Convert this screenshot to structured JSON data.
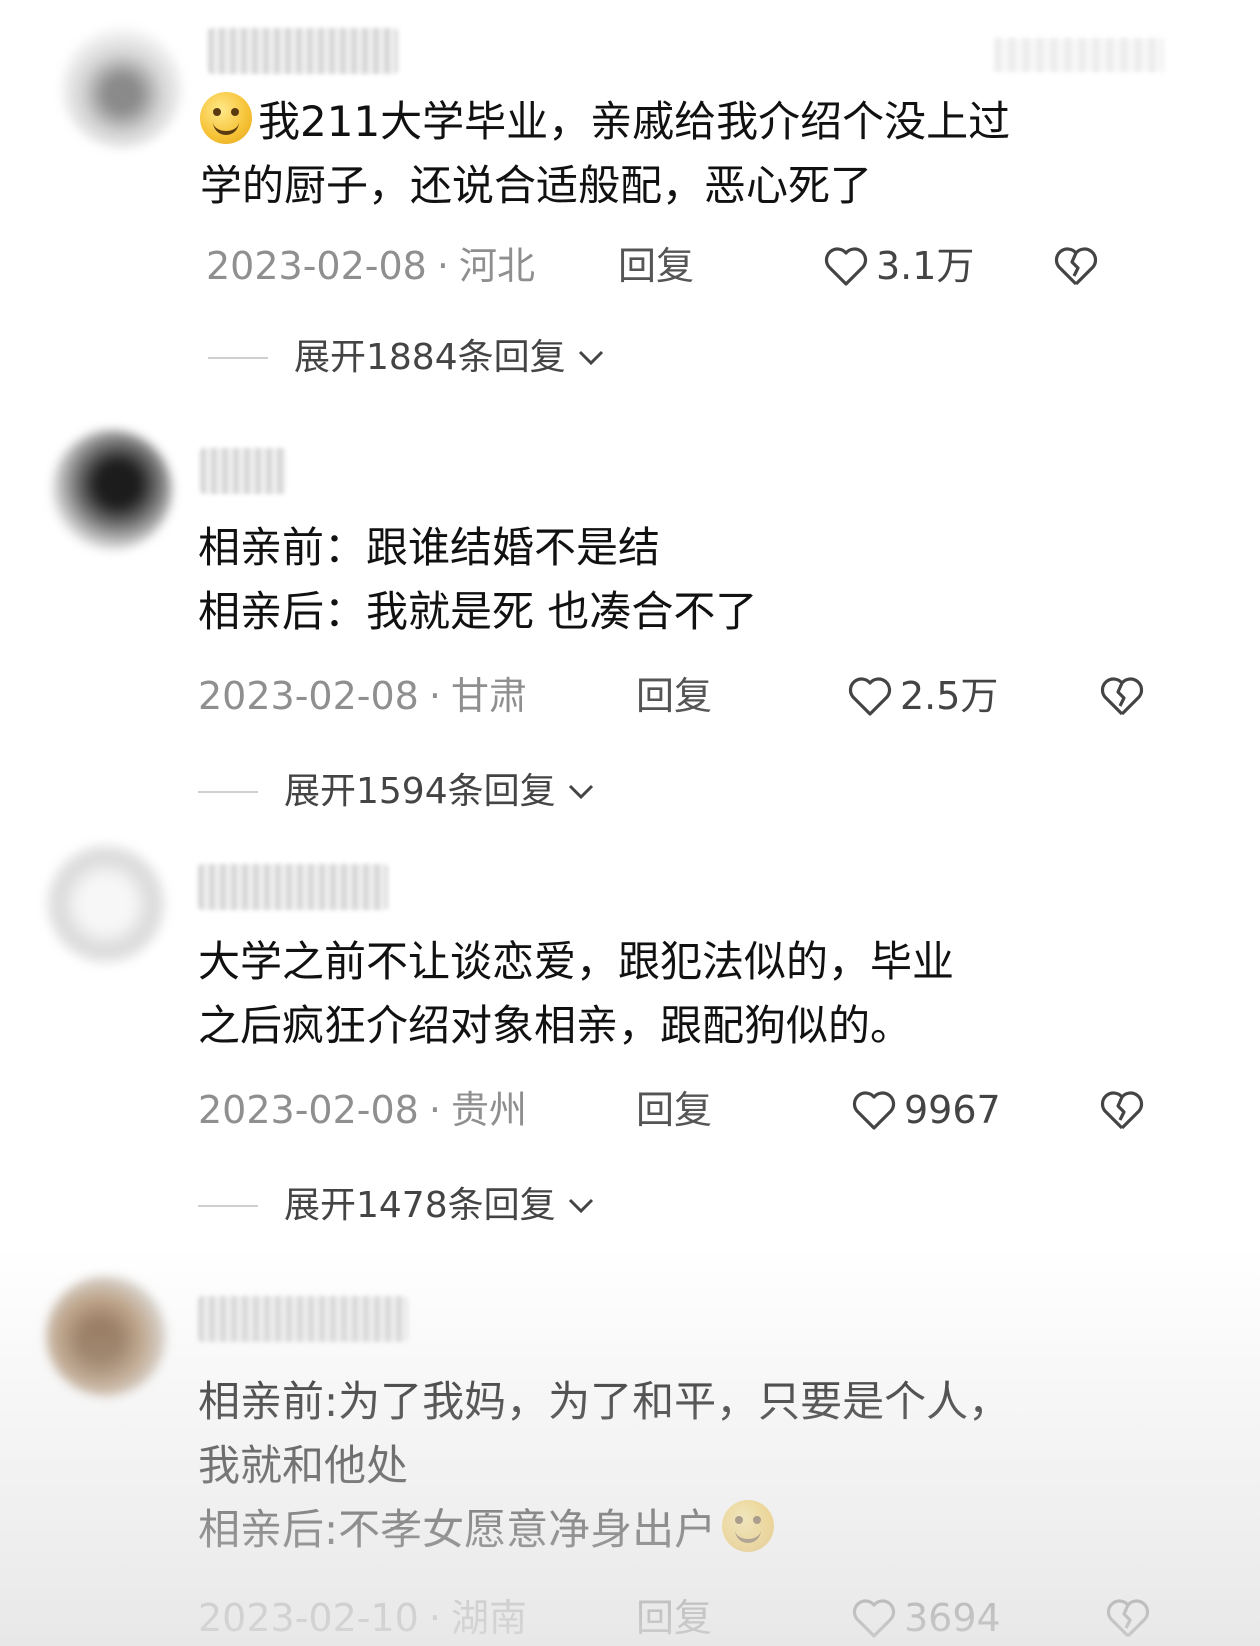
{
  "comments": [
    {
      "text": "我211大学毕业，亲戚给我介绍个没上过\n学的厨子，还说合适般配，恶心死了",
      "date": "2023-02-08",
      "location": "河北",
      "reply_label": "回复",
      "likes": "3.1万",
      "expand_label": "展开1884条回复",
      "emoji": "sweat-smile-emoji"
    },
    {
      "text": "相亲前：跟谁结婚不是结\n相亲后：我就是死 也凑合不了",
      "date": "2023-02-08",
      "location": "甘肃",
      "reply_label": "回复",
      "likes": "2.5万",
      "expand_label": "展开1594条回复"
    },
    {
      "text": "大学之前不让谈恋爱，跟犯法似的，毕业\n之后疯狂介绍对象相亲，跟配狗似的。",
      "date": "2023-02-08",
      "location": "贵州",
      "reply_label": "回复",
      "likes": "9967",
      "expand_label": "展开1478条回复"
    },
    {
      "text": "相亲前:为了我妈，为了和平，只要是个人，\n我就和他处\n相亲后:不孝女愿意净身出户",
      "date": "2023-02-10",
      "location": "湖南",
      "reply_label": "回复",
      "likes": "3694",
      "emoji": "smile-emoji"
    }
  ],
  "separator": "·",
  "colors": {
    "text": "#111111",
    "meta": "#8f8f8f",
    "icon": "#444444"
  },
  "icons": {
    "like": "heart-outline-icon",
    "dislike": "broken-heart-icon",
    "expand": "chevron-down-icon"
  }
}
